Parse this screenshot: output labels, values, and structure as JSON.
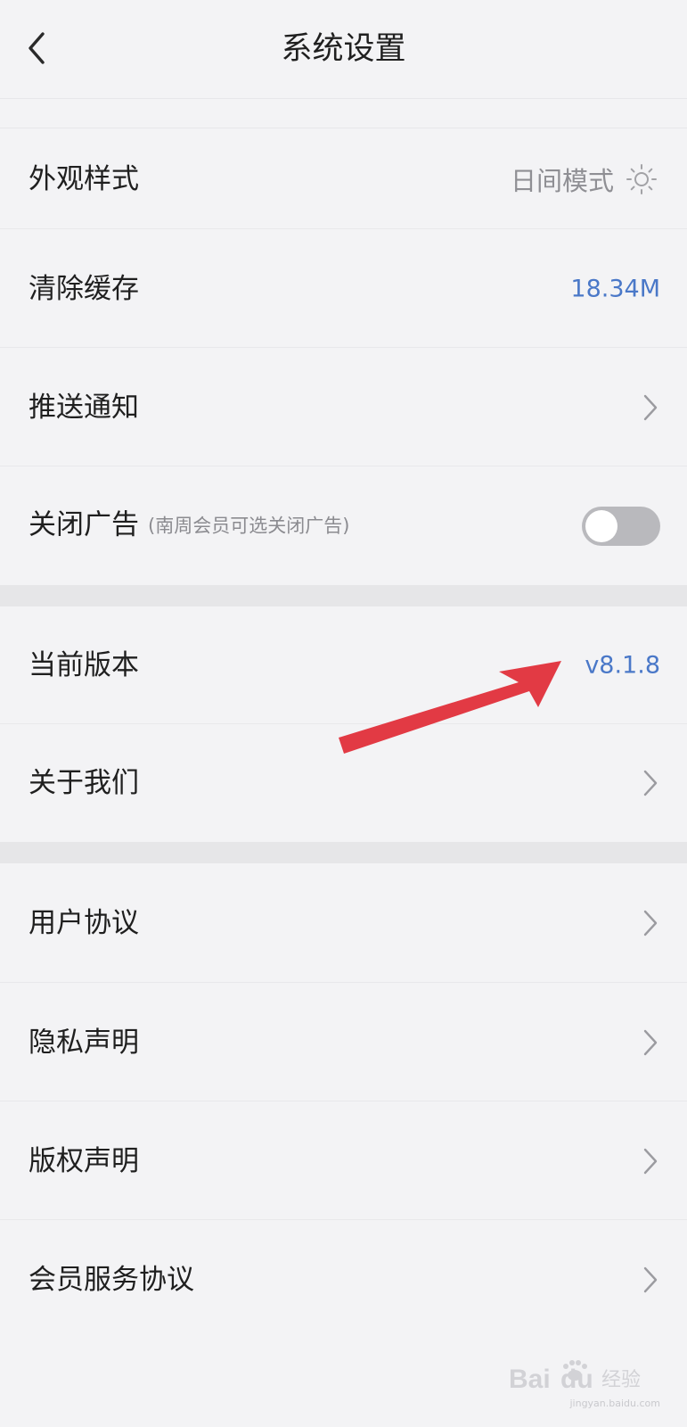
{
  "header": {
    "title": "系统设置",
    "back_icon": "chevron-left-icon"
  },
  "appearance": {
    "label": "外观样式",
    "value": "日间模式",
    "icon": "sun-icon"
  },
  "cache": {
    "label": "清除缓存",
    "value": "18.34M"
  },
  "push": {
    "label": "推送通知"
  },
  "ads": {
    "label": "关闭广告",
    "sub": "(南周会员可选关闭广告)",
    "toggle_on": false
  },
  "version": {
    "label": "当前版本",
    "value": "v8.1.8"
  },
  "about": {
    "label": "关于我们"
  },
  "user_agreement": {
    "label": "用户协议"
  },
  "privacy": {
    "label": "隐私声明"
  },
  "copyright": {
    "label": "版权声明"
  },
  "member_agreement": {
    "label": "会员服务协议"
  },
  "watermark": {
    "logo": "Baidu经验",
    "url": "jingyan.baidu.com"
  },
  "colors": {
    "accent_blue": "#4a78c8",
    "annotation_red": "#e23a44",
    "background": "#f3f3f5"
  }
}
